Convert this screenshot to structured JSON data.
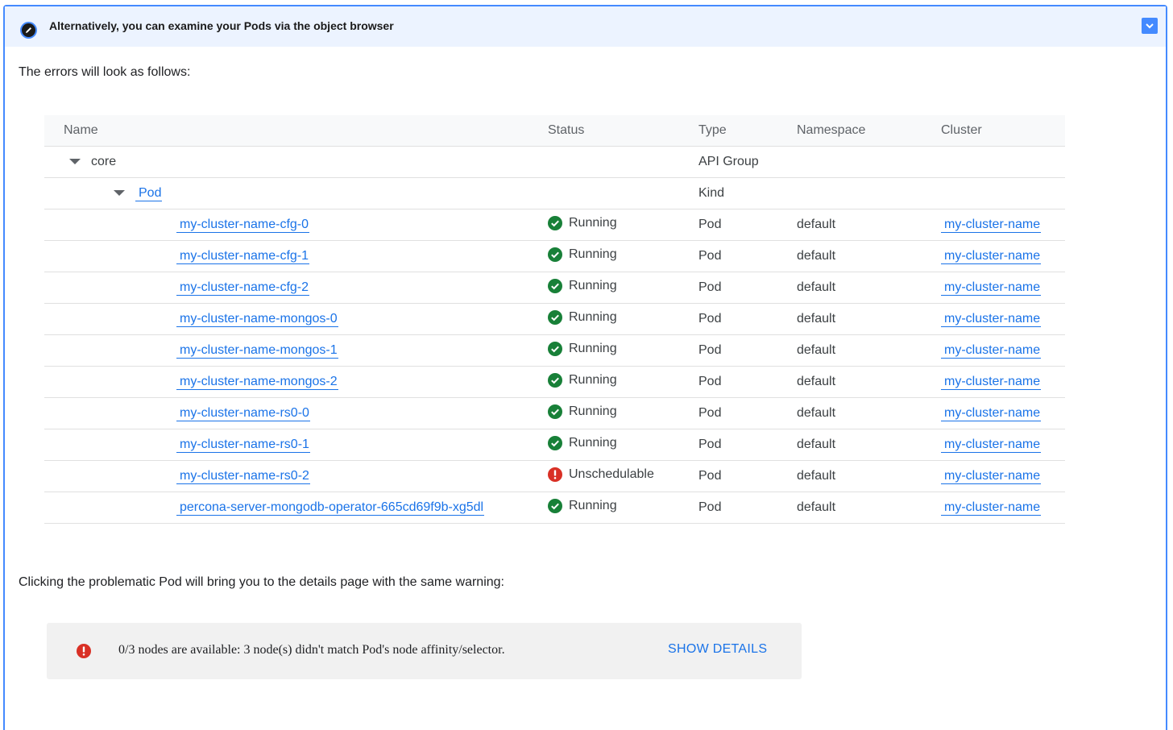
{
  "panel": {
    "title": "Alternatively, you can examine your Pods via the object browser",
    "header_icon": "pencil-icon",
    "toggle_icon": "chevron-down-icon",
    "accent_color": "#448aff",
    "header_bg": "#ecf3ff"
  },
  "intro_text": "The errors will look as follows:",
  "table": {
    "columns": [
      "Name",
      "Status",
      "Type",
      "Namespace",
      "Cluster"
    ],
    "group_row": {
      "name": "core",
      "type": "API Group"
    },
    "kind_row": {
      "name": "Pod",
      "type": "Kind"
    },
    "rows": [
      {
        "name": "my-cluster-name-cfg-0",
        "status": "Running",
        "status_kind": "ok",
        "type": "Pod",
        "namespace": "default",
        "cluster": "my-cluster-name"
      },
      {
        "name": "my-cluster-name-cfg-1",
        "status": "Running",
        "status_kind": "ok",
        "type": "Pod",
        "namespace": "default",
        "cluster": "my-cluster-name"
      },
      {
        "name": "my-cluster-name-cfg-2",
        "status": "Running",
        "status_kind": "ok",
        "type": "Pod",
        "namespace": "default",
        "cluster": "my-cluster-name"
      },
      {
        "name": "my-cluster-name-mongos-0",
        "status": "Running",
        "status_kind": "ok",
        "type": "Pod",
        "namespace": "default",
        "cluster": "my-cluster-name"
      },
      {
        "name": "my-cluster-name-mongos-1",
        "status": "Running",
        "status_kind": "ok",
        "type": "Pod",
        "namespace": "default",
        "cluster": "my-cluster-name"
      },
      {
        "name": "my-cluster-name-mongos-2",
        "status": "Running",
        "status_kind": "ok",
        "type": "Pod",
        "namespace": "default",
        "cluster": "my-cluster-name"
      },
      {
        "name": "my-cluster-name-rs0-0",
        "status": "Running",
        "status_kind": "ok",
        "type": "Pod",
        "namespace": "default",
        "cluster": "my-cluster-name"
      },
      {
        "name": "my-cluster-name-rs0-1",
        "status": "Running",
        "status_kind": "ok",
        "type": "Pod",
        "namespace": "default",
        "cluster": "my-cluster-name"
      },
      {
        "name": "my-cluster-name-rs0-2",
        "status": "Unschedulable",
        "status_kind": "error",
        "type": "Pod",
        "namespace": "default",
        "cluster": "my-cluster-name"
      },
      {
        "name": "percona-server-mongodb-operator-665cd69f9b-xg5dl",
        "status": "Running",
        "status_kind": "ok",
        "type": "Pod",
        "namespace": "default",
        "cluster": "my-cluster-name"
      }
    ],
    "ok_color": "#188038",
    "error_color": "#d93025",
    "link_color": "#1a73e8"
  },
  "second_text": "Clicking the problematic Pod will bring you to the details page with the same warning:",
  "alert": {
    "icon": "error-icon",
    "message": "0/3 nodes are available: 3 node(s) didn't match Pod's node affinity/selector.",
    "action_label": "SHOW DETAILS"
  }
}
